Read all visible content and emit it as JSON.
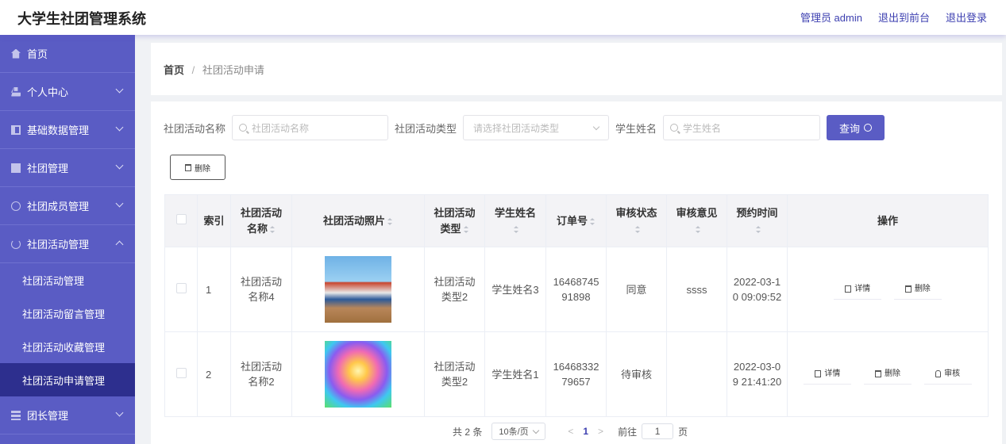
{
  "header": {
    "title": "大学生社团管理系统",
    "links": [
      "管理员 admin",
      "退出到前台",
      "退出登录"
    ]
  },
  "sidebar": {
    "items": [
      {
        "label": "首页",
        "icon": "home-icon"
      },
      {
        "label": "个人中心",
        "icon": "user-icon"
      },
      {
        "label": "基础数据管理",
        "icon": "grid-icon"
      },
      {
        "label": "社团管理",
        "icon": "monitor-icon"
      },
      {
        "label": "社团成员管理",
        "icon": "clock-icon"
      },
      {
        "label": "社团活动管理",
        "icon": "power-icon"
      }
    ],
    "subitems": [
      "社团活动管理",
      "社团活动留言管理",
      "社团活动收藏管理",
      "社团活动申请管理"
    ],
    "last_item": {
      "label": "团长管理",
      "icon": "stack-icon"
    }
  },
  "breadcrumb": {
    "home": "首页",
    "sep": "/",
    "current": "社团活动申请"
  },
  "search": {
    "name_label": "社团活动名称",
    "name_placeholder": "社团活动名称",
    "type_label": "社团活动类型",
    "type_placeholder": "请选择社团活动类型",
    "student_label": "学生姓名",
    "student_placeholder": "学生姓名",
    "query_label": "查询"
  },
  "toolbar": {
    "delete_label": "删除"
  },
  "table": {
    "headers": {
      "index": "索引",
      "name": "社团活动名称",
      "photo": "社团活动照片",
      "type": "社团活动类型",
      "student": "学生姓名",
      "order": "订单号",
      "status": "审核状态",
      "opinion": "审核意见",
      "time": "预约时间",
      "actions": "操作"
    },
    "rows": [
      {
        "index": "1",
        "name": "社团活动名称4",
        "type": "社团活动类型2",
        "student": "学生姓名3",
        "order": "1646874591898",
        "status": "同意",
        "opinion": "ssss",
        "time": "2022-03-10 09:09:52"
      },
      {
        "index": "2",
        "name": "社团活动名称2",
        "type": "社团活动类型2",
        "student": "学生姓名1",
        "order": "1646833279657",
        "status": "待审核",
        "opinion": "",
        "time": "2022-03-09 21:41:20"
      }
    ],
    "action_labels": {
      "detail": "详情",
      "delete": "删除",
      "review": "审核"
    }
  },
  "pagination": {
    "total": "共 2 条",
    "page_size": "10条/页",
    "prev": "<",
    "current_page": "1",
    "next": ">",
    "goto_label": "前往",
    "goto_value": "1",
    "page_suffix": "页"
  },
  "colors": {
    "accent": "#5a5cc4",
    "sidebar_active": "#2d2f8e"
  }
}
